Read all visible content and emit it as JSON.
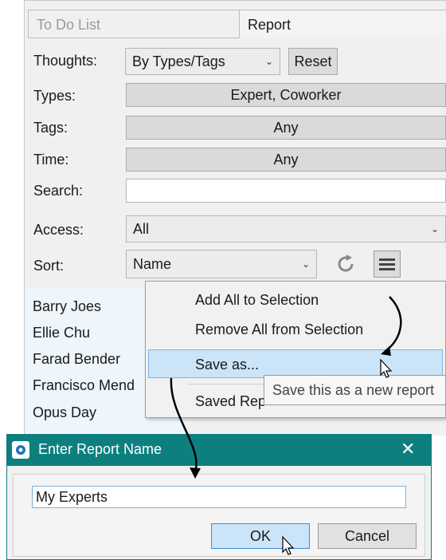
{
  "tabs": {
    "todo": "To Do List",
    "report": "Report"
  },
  "filters": {
    "thoughts_label": "Thoughts:",
    "thoughts_value": "By Types/Tags",
    "reset_label": "Reset",
    "types_label": "Types:",
    "types_value": "Expert, Coworker",
    "tags_label": "Tags:",
    "tags_value": "Any",
    "time_label": "Time:",
    "time_value": "Any",
    "search_label": "Search:",
    "search_value": "",
    "access_label": "Access:",
    "access_value": "All",
    "sort_label": "Sort:",
    "sort_value": "Name"
  },
  "list": [
    "Barry Joes",
    "Ellie Chu",
    "Farad Bender",
    "Francisco Mend",
    "Opus Day"
  ],
  "menu": {
    "add_all": "Add All to Selection",
    "remove_all": "Remove All from Selection",
    "save_as": "Save as...",
    "saved": "Saved Rep"
  },
  "tooltip": "Save this as a new report",
  "dialog": {
    "title": "Enter Report Name",
    "close": "✕",
    "input_value": "My Experts",
    "ok_label": "OK",
    "cancel_label": "Cancel"
  },
  "icons": {
    "refresh": "refresh-icon",
    "menu": "hamburger-menu-icon",
    "app": "app-logo-icon",
    "cursor": "mouse-pointer-icon"
  },
  "colors": {
    "dialog_titlebar": "#0d7f7f",
    "highlight": "#cce4f7"
  }
}
